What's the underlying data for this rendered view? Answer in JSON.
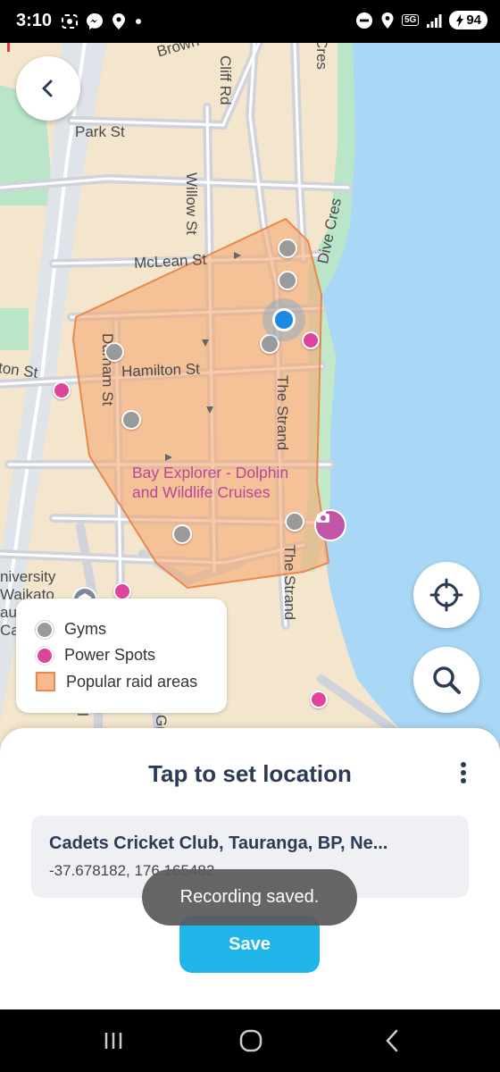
{
  "status_bar": {
    "time": "3:10",
    "network": "5G",
    "battery": "94",
    "left_icons": [
      "screenshot-icon",
      "messenger-icon",
      "location-pin-icon",
      "dot-icon"
    ],
    "right_icons": [
      "do-not-disturb-icon",
      "location-icon",
      "5g-icon",
      "signal-icon",
      "battery-icon"
    ]
  },
  "map": {
    "streets": {
      "brown": "Brown S",
      "cliff": "Cliff Rd",
      "park": "Park St",
      "willow": "Willow St",
      "mclean": "McLean St",
      "dive": "Dive Cres",
      "cres": "Cres",
      "hamilton_left": "ton St",
      "durham": "Durham St",
      "hamilton": "Hamilton St",
      "strand": "The Strand",
      "strand2": "The Strand",
      "university_1": "niversity",
      "university_2": "Waikato",
      "university_3": "au",
      "university_4": "Ca",
      "gr": "Gr",
      "l": "l"
    },
    "poi": {
      "line1": "Bay Explorer - Dolphin",
      "line2": "and Wildlife Cruises"
    },
    "colors": {
      "land": "#f3e6cc",
      "water": "#a9d8f7",
      "park": "#b9e6c8",
      "raid_area_fill": "#f7b98f",
      "raid_area_stroke": "#e9874c",
      "gym": "#9a9a9a",
      "power_spot": "#e0449a",
      "user": "#1e88e5"
    }
  },
  "legend": {
    "gyms": "Gyms",
    "power_spots": "Power Spots",
    "raid_areas": "Popular raid areas"
  },
  "sheet": {
    "title": "Tap to set location",
    "location_name": "Cadets Cricket Club, Tauranga, BP, Ne...",
    "coordinates": "-37.678182, 176.165482",
    "save_label": "Save"
  },
  "toast": "Recording saved.",
  "nav_icons": [
    "recent-apps-icon",
    "home-icon",
    "back-icon"
  ]
}
